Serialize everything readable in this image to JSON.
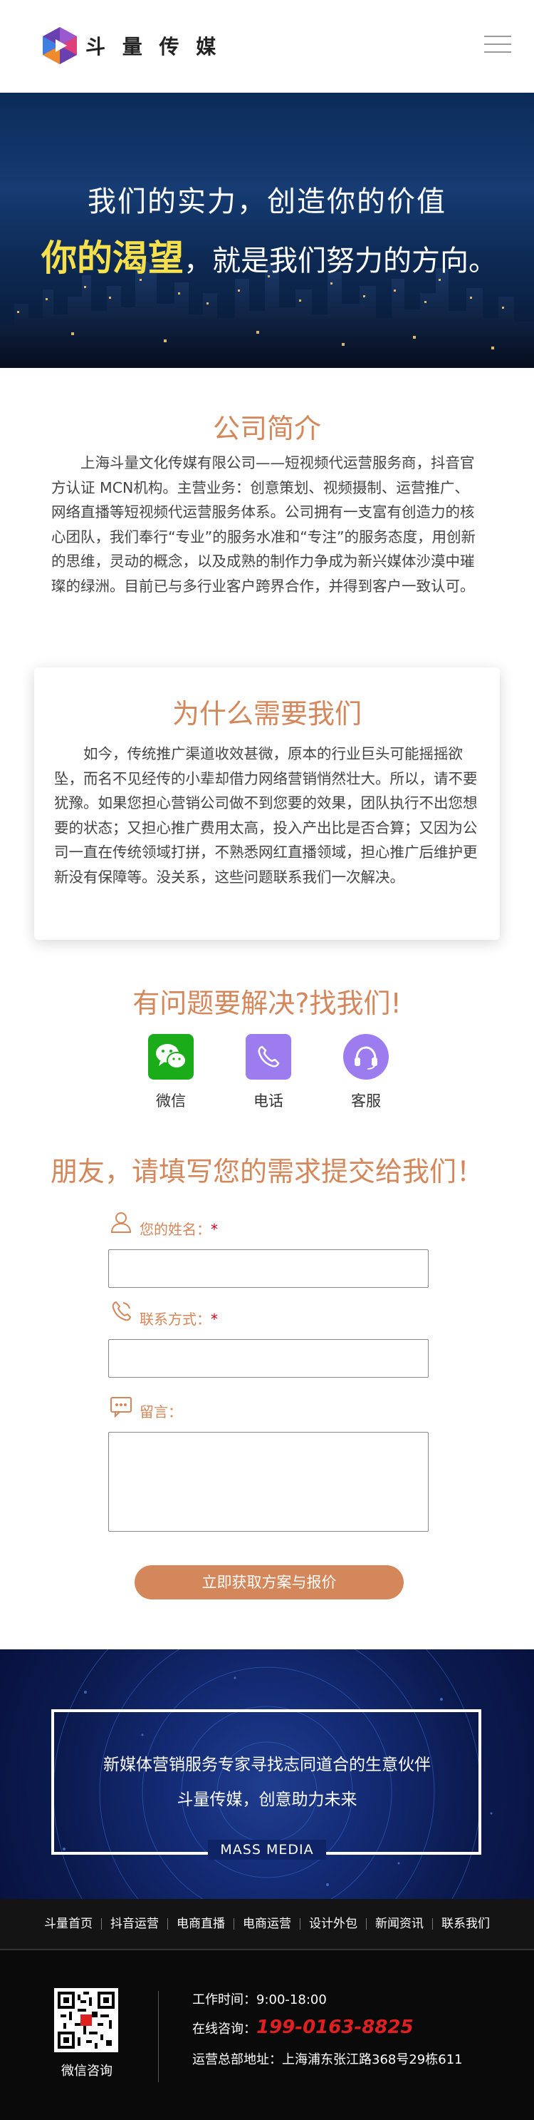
{
  "header": {
    "brand": "斗 量 传 媒",
    "logo_icon": "hexagon-play-logo",
    "menu_icon": "hamburger-menu-icon"
  },
  "banner": {
    "line1": "我们的实力，创造你的价值",
    "highlight": "你的渴望",
    "line2_rest": "，就是我们努力的方向。"
  },
  "about": {
    "title": "公司简介",
    "body": "上海斗量文化传媒有限公司——短视频代运营服务商，抖音官方认证 MCN机构。主营业务：创意策划、视频摄制、运营推广、网络直播等短视频代运营服务体系。公司拥有一支富有创造力的核心团队，我们奉行“专业”的服务水准和“专注”的服务态度，用创新的思维，灵动的概念，以及成熟的制作力争成为新兴媒体沙漠中璀璨的绿洲。目前已与多行业客户跨界合作，并得到客户一致认可。"
  },
  "why": {
    "title": "为什么需要我们",
    "body": "如今，传统推广渠道收效甚微，原本的行业巨头可能摇摇欲坠，而名不见经传的小辈却借力网络营销悄然壮大。所以，请不要犹豫。如果您担心营销公司做不到您要的效果，团队执行不出您想要的状态；又担心推广费用太高，投入产出比是否合算；又因为公司一直在传统领域打拼，不熟悉网红直播领域，担心推广后维护更新没有保障等。没关系，这些问题联系我们一次解决。"
  },
  "help": {
    "title": "有问题要解决?找我们!",
    "items": [
      {
        "label": "微信",
        "icon": "wechat-icon",
        "color": "#1aad19"
      },
      {
        "label": "电话",
        "icon": "phone-icon",
        "color": "#9d7cf0"
      },
      {
        "label": "客服",
        "icon": "headset-icon",
        "color": "#9d7cf0"
      }
    ]
  },
  "form": {
    "title": "朋友，请填写您的需求提交给我们！",
    "name_label": "您的姓名：",
    "contact_label": "联系方式：",
    "message_label": "留言：",
    "required_mark": "*",
    "name_value": "",
    "contact_value": "",
    "message_value": "",
    "submit_label": "立即获取方案与报价"
  },
  "promo": {
    "line1": "新媒体营销服务专家寻找志同道合的生意伙伴",
    "line2": "斗量传媒，创意助力未来",
    "tag": "MASS MEDIA"
  },
  "footer": {
    "nav": [
      "斗量首页",
      "抖音运营",
      "电商直播",
      "电商运营",
      "设计外包",
      "新闻资讯",
      "联系我们"
    ],
    "qr_label": "微信咨询",
    "hours": "工作时间：9:00-18:00",
    "consult_label": "在线咨询：",
    "phone": "199-0163-8825",
    "address": "运营总部地址：上海浦东张江路368号29栋611"
  },
  "colors": {
    "accent": "#d4875a",
    "highlight": "#f6e04b",
    "phone_red": "#e02020"
  }
}
